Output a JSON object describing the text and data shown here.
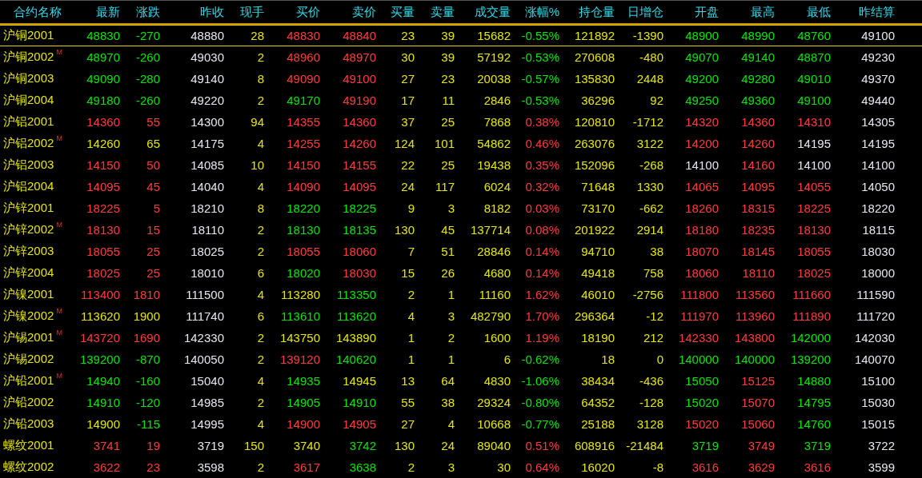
{
  "table": {
    "columns": [
      "合约名称",
      "最新",
      "涨跌",
      "昨收",
      "现手",
      "买价",
      "卖价",
      "买量",
      "卖量",
      "成交量",
      "涨幅%",
      "持仓量",
      "日增仓",
      "开盘",
      "最高",
      "最低",
      "昨结算"
    ],
    "rows": [
      {
        "selected": true,
        "cells": [
          {
            "text": "沪铜2001"
          },
          {
            "text": "48830",
            "color": "#00e600"
          },
          {
            "text": "-270",
            "color": "#00e600"
          },
          {
            "text": "48880",
            "color": "#e6e6f0"
          },
          {
            "text": "28",
            "color": "#e6e600"
          },
          {
            "text": "48830",
            "color": "#ff3c3c"
          },
          {
            "text": "48840",
            "color": "#ff3c3c"
          },
          {
            "text": "23",
            "color": "#e6e600"
          },
          {
            "text": "39",
            "color": "#e6e600"
          },
          {
            "text": "15682",
            "color": "#e6e600"
          },
          {
            "text": "-0.55%",
            "color": "#00e600"
          },
          {
            "text": "121892",
            "color": "#e6e600"
          },
          {
            "text": "-1390",
            "color": "#e6e600"
          },
          {
            "text": "48900",
            "color": "#00e600"
          },
          {
            "text": "48990",
            "color": "#00e600"
          },
          {
            "text": "48760",
            "color": "#00e600"
          },
          {
            "text": "49100",
            "color": "#e6e6f0"
          }
        ]
      },
      {
        "selected": false,
        "cells": [
          {
            "text": "沪铜2002",
            "marker": "M"
          },
          {
            "text": "48970",
            "color": "#00e600"
          },
          {
            "text": "-260",
            "color": "#00e600"
          },
          {
            "text": "49030",
            "color": "#e6e6f0"
          },
          {
            "text": "2",
            "color": "#e6e600"
          },
          {
            "text": "48960",
            "color": "#ff3c3c"
          },
          {
            "text": "48970",
            "color": "#ff3c3c"
          },
          {
            "text": "30",
            "color": "#e6e600"
          },
          {
            "text": "39",
            "color": "#e6e600"
          },
          {
            "text": "57192",
            "color": "#e6e600"
          },
          {
            "text": "-0.53%",
            "color": "#00e600"
          },
          {
            "text": "270608",
            "color": "#e6e600"
          },
          {
            "text": "-480",
            "color": "#e6e600"
          },
          {
            "text": "49070",
            "color": "#00e600"
          },
          {
            "text": "49140",
            "color": "#00e600"
          },
          {
            "text": "48870",
            "color": "#00e600"
          },
          {
            "text": "49230",
            "color": "#e6e6f0"
          }
        ]
      },
      {
        "selected": false,
        "cells": [
          {
            "text": "沪铜2003"
          },
          {
            "text": "49090",
            "color": "#00e600"
          },
          {
            "text": "-280",
            "color": "#00e600"
          },
          {
            "text": "49140",
            "color": "#e6e6f0"
          },
          {
            "text": "8",
            "color": "#e6e600"
          },
          {
            "text": "49090",
            "color": "#ff3c3c"
          },
          {
            "text": "49100",
            "color": "#ff3c3c"
          },
          {
            "text": "27",
            "color": "#e6e600"
          },
          {
            "text": "23",
            "color": "#e6e600"
          },
          {
            "text": "20038",
            "color": "#e6e600"
          },
          {
            "text": "-0.57%",
            "color": "#00e600"
          },
          {
            "text": "135830",
            "color": "#e6e600"
          },
          {
            "text": "2448",
            "color": "#e6e600"
          },
          {
            "text": "49200",
            "color": "#00e600"
          },
          {
            "text": "49280",
            "color": "#00e600"
          },
          {
            "text": "49010",
            "color": "#00e600"
          },
          {
            "text": "49370",
            "color": "#e6e6f0"
          }
        ]
      },
      {
        "selected": false,
        "cells": [
          {
            "text": "沪铜2004"
          },
          {
            "text": "49180",
            "color": "#00e600"
          },
          {
            "text": "-260",
            "color": "#00e600"
          },
          {
            "text": "49220",
            "color": "#e6e6f0"
          },
          {
            "text": "2",
            "color": "#e6e600"
          },
          {
            "text": "49170",
            "color": "#00e600"
          },
          {
            "text": "49190",
            "color": "#ff3c3c"
          },
          {
            "text": "17",
            "color": "#e6e600"
          },
          {
            "text": "11",
            "color": "#e6e600"
          },
          {
            "text": "2846",
            "color": "#e6e600"
          },
          {
            "text": "-0.53%",
            "color": "#00e600"
          },
          {
            "text": "36296",
            "color": "#e6e600"
          },
          {
            "text": "92",
            "color": "#e6e600"
          },
          {
            "text": "49250",
            "color": "#00e600"
          },
          {
            "text": "49360",
            "color": "#00e600"
          },
          {
            "text": "49100",
            "color": "#00e600"
          },
          {
            "text": "49440",
            "color": "#e6e6f0"
          }
        ]
      },
      {
        "selected": false,
        "cells": [
          {
            "text": "沪铝2001"
          },
          {
            "text": "14360",
            "color": "#ff3c3c"
          },
          {
            "text": "55",
            "color": "#ff3c3c"
          },
          {
            "text": "14300",
            "color": "#e6e6f0"
          },
          {
            "text": "94",
            "color": "#e6e600"
          },
          {
            "text": "14355",
            "color": "#ff3c3c"
          },
          {
            "text": "14360",
            "color": "#ff3c3c"
          },
          {
            "text": "37",
            "color": "#e6e600"
          },
          {
            "text": "25",
            "color": "#e6e600"
          },
          {
            "text": "7868",
            "color": "#e6e600"
          },
          {
            "text": "0.38%",
            "color": "#ff3c3c"
          },
          {
            "text": "120810",
            "color": "#e6e600"
          },
          {
            "text": "-1712",
            "color": "#e6e600"
          },
          {
            "text": "14320",
            "color": "#ff3c3c"
          },
          {
            "text": "14360",
            "color": "#ff3c3c"
          },
          {
            "text": "14310",
            "color": "#ff3c3c"
          },
          {
            "text": "14305",
            "color": "#e6e6f0"
          }
        ]
      },
      {
        "selected": false,
        "cells": [
          {
            "text": "沪铝2002",
            "marker": "M"
          },
          {
            "text": "14260",
            "color": "#e6e600"
          },
          {
            "text": "65",
            "color": "#e6e600"
          },
          {
            "text": "14175",
            "color": "#e6e6f0"
          },
          {
            "text": "4",
            "color": "#e6e600"
          },
          {
            "text": "14255",
            "color": "#ff3c3c"
          },
          {
            "text": "14260",
            "color": "#ff3c3c"
          },
          {
            "text": "124",
            "color": "#e6e600"
          },
          {
            "text": "101",
            "color": "#e6e600"
          },
          {
            "text": "54862",
            "color": "#e6e600"
          },
          {
            "text": "0.46%",
            "color": "#ff3c3c"
          },
          {
            "text": "263076",
            "color": "#e6e600"
          },
          {
            "text": "3122",
            "color": "#e6e600"
          },
          {
            "text": "14200",
            "color": "#ff3c3c"
          },
          {
            "text": "14260",
            "color": "#ff3c3c"
          },
          {
            "text": "14195",
            "color": "#e6e6f0"
          },
          {
            "text": "14195",
            "color": "#e6e6f0"
          }
        ]
      },
      {
        "selected": false,
        "cells": [
          {
            "text": "沪铝2003"
          },
          {
            "text": "14150",
            "color": "#ff3c3c"
          },
          {
            "text": "50",
            "color": "#ff3c3c"
          },
          {
            "text": "14085",
            "color": "#e6e6f0"
          },
          {
            "text": "10",
            "color": "#e6e600"
          },
          {
            "text": "14150",
            "color": "#ff3c3c"
          },
          {
            "text": "14155",
            "color": "#ff3c3c"
          },
          {
            "text": "22",
            "color": "#e6e600"
          },
          {
            "text": "25",
            "color": "#e6e600"
          },
          {
            "text": "19438",
            "color": "#e6e600"
          },
          {
            "text": "0.35%",
            "color": "#ff3c3c"
          },
          {
            "text": "152096",
            "color": "#e6e600"
          },
          {
            "text": "-268",
            "color": "#e6e600"
          },
          {
            "text": "14100",
            "color": "#e6e6f0"
          },
          {
            "text": "14160",
            "color": "#ff3c3c"
          },
          {
            "text": "14100",
            "color": "#e6e6f0"
          },
          {
            "text": "14100",
            "color": "#e6e6f0"
          }
        ]
      },
      {
        "selected": false,
        "cells": [
          {
            "text": "沪铝2004"
          },
          {
            "text": "14095",
            "color": "#ff3c3c"
          },
          {
            "text": "45",
            "color": "#ff3c3c"
          },
          {
            "text": "14040",
            "color": "#e6e6f0"
          },
          {
            "text": "4",
            "color": "#e6e600"
          },
          {
            "text": "14090",
            "color": "#ff3c3c"
          },
          {
            "text": "14095",
            "color": "#ff3c3c"
          },
          {
            "text": "24",
            "color": "#e6e600"
          },
          {
            "text": "117",
            "color": "#e6e600"
          },
          {
            "text": "6024",
            "color": "#e6e600"
          },
          {
            "text": "0.32%",
            "color": "#ff3c3c"
          },
          {
            "text": "71648",
            "color": "#e6e600"
          },
          {
            "text": "1330",
            "color": "#e6e600"
          },
          {
            "text": "14065",
            "color": "#ff3c3c"
          },
          {
            "text": "14095",
            "color": "#ff3c3c"
          },
          {
            "text": "14055",
            "color": "#ff3c3c"
          },
          {
            "text": "14050",
            "color": "#e6e6f0"
          }
        ]
      },
      {
        "selected": false,
        "cells": [
          {
            "text": "沪锌2001"
          },
          {
            "text": "18225",
            "color": "#ff3c3c"
          },
          {
            "text": "5",
            "color": "#ff3c3c"
          },
          {
            "text": "18210",
            "color": "#e6e6f0"
          },
          {
            "text": "8",
            "color": "#e6e600"
          },
          {
            "text": "18220",
            "color": "#00e600"
          },
          {
            "text": "18225",
            "color": "#00e600"
          },
          {
            "text": "9",
            "color": "#e6e600"
          },
          {
            "text": "3",
            "color": "#e6e600"
          },
          {
            "text": "8182",
            "color": "#e6e600"
          },
          {
            "text": "0.03%",
            "color": "#ff3c3c"
          },
          {
            "text": "73170",
            "color": "#e6e600"
          },
          {
            "text": "-662",
            "color": "#e6e600"
          },
          {
            "text": "18260",
            "color": "#ff3c3c"
          },
          {
            "text": "18315",
            "color": "#ff3c3c"
          },
          {
            "text": "18225",
            "color": "#ff3c3c"
          },
          {
            "text": "18220",
            "color": "#e6e6f0"
          }
        ]
      },
      {
        "selected": false,
        "cells": [
          {
            "text": "沪锌2002",
            "marker": "M"
          },
          {
            "text": "18130",
            "color": "#ff3c3c"
          },
          {
            "text": "15",
            "color": "#ff3c3c"
          },
          {
            "text": "18110",
            "color": "#e6e6f0"
          },
          {
            "text": "2",
            "color": "#e6e600"
          },
          {
            "text": "18130",
            "color": "#00e600"
          },
          {
            "text": "18135",
            "color": "#00e600"
          },
          {
            "text": "130",
            "color": "#e6e600"
          },
          {
            "text": "45",
            "color": "#e6e600"
          },
          {
            "text": "137714",
            "color": "#e6e600"
          },
          {
            "text": "0.08%",
            "color": "#ff3c3c"
          },
          {
            "text": "201922",
            "color": "#e6e600"
          },
          {
            "text": "2914",
            "color": "#e6e600"
          },
          {
            "text": "18180",
            "color": "#ff3c3c"
          },
          {
            "text": "18235",
            "color": "#ff3c3c"
          },
          {
            "text": "18130",
            "color": "#ff3c3c"
          },
          {
            "text": "18115",
            "color": "#e6e6f0"
          }
        ]
      },
      {
        "selected": false,
        "cells": [
          {
            "text": "沪锌2003"
          },
          {
            "text": "18055",
            "color": "#ff3c3c"
          },
          {
            "text": "25",
            "color": "#ff3c3c"
          },
          {
            "text": "18025",
            "color": "#e6e6f0"
          },
          {
            "text": "2",
            "color": "#e6e600"
          },
          {
            "text": "18055",
            "color": "#ff3c3c"
          },
          {
            "text": "18060",
            "color": "#ff3c3c"
          },
          {
            "text": "7",
            "color": "#e6e600"
          },
          {
            "text": "51",
            "color": "#e6e600"
          },
          {
            "text": "28846",
            "color": "#e6e600"
          },
          {
            "text": "0.14%",
            "color": "#ff3c3c"
          },
          {
            "text": "94710",
            "color": "#e6e600"
          },
          {
            "text": "38",
            "color": "#e6e600"
          },
          {
            "text": "18070",
            "color": "#ff3c3c"
          },
          {
            "text": "18145",
            "color": "#ff3c3c"
          },
          {
            "text": "18055",
            "color": "#ff3c3c"
          },
          {
            "text": "18030",
            "color": "#e6e6f0"
          }
        ]
      },
      {
        "selected": false,
        "cells": [
          {
            "text": "沪锌2004"
          },
          {
            "text": "18025",
            "color": "#ff3c3c"
          },
          {
            "text": "25",
            "color": "#ff3c3c"
          },
          {
            "text": "18010",
            "color": "#e6e6f0"
          },
          {
            "text": "6",
            "color": "#e6e600"
          },
          {
            "text": "18020",
            "color": "#00e600"
          },
          {
            "text": "18030",
            "color": "#ff3c3c"
          },
          {
            "text": "15",
            "color": "#e6e600"
          },
          {
            "text": "26",
            "color": "#e6e600"
          },
          {
            "text": "4680",
            "color": "#e6e600"
          },
          {
            "text": "0.14%",
            "color": "#ff3c3c"
          },
          {
            "text": "49418",
            "color": "#e6e600"
          },
          {
            "text": "758",
            "color": "#e6e600"
          },
          {
            "text": "18060",
            "color": "#ff3c3c"
          },
          {
            "text": "18110",
            "color": "#ff3c3c"
          },
          {
            "text": "18025",
            "color": "#ff3c3c"
          },
          {
            "text": "18000",
            "color": "#e6e6f0"
          }
        ]
      },
      {
        "selected": false,
        "cells": [
          {
            "text": "沪镍2001"
          },
          {
            "text": "113400",
            "color": "#ff3c3c"
          },
          {
            "text": "1810",
            "color": "#ff3c3c"
          },
          {
            "text": "111500",
            "color": "#e6e6f0"
          },
          {
            "text": "4",
            "color": "#e6e600"
          },
          {
            "text": "113280",
            "color": "#e6e600"
          },
          {
            "text": "113350",
            "color": "#00e600"
          },
          {
            "text": "2",
            "color": "#e6e600"
          },
          {
            "text": "1",
            "color": "#e6e600"
          },
          {
            "text": "11160",
            "color": "#e6e600"
          },
          {
            "text": "1.62%",
            "color": "#ff3c3c"
          },
          {
            "text": "46010",
            "color": "#e6e600"
          },
          {
            "text": "-2756",
            "color": "#e6e600"
          },
          {
            "text": "111800",
            "color": "#ff3c3c"
          },
          {
            "text": "113560",
            "color": "#ff3c3c"
          },
          {
            "text": "111660",
            "color": "#ff3c3c"
          },
          {
            "text": "111590",
            "color": "#e6e6f0"
          }
        ]
      },
      {
        "selected": false,
        "cells": [
          {
            "text": "沪镍2002",
            "marker": "M"
          },
          {
            "text": "113620",
            "color": "#e6e600"
          },
          {
            "text": "1900",
            "color": "#e6e600"
          },
          {
            "text": "111740",
            "color": "#e6e6f0"
          },
          {
            "text": "6",
            "color": "#e6e600"
          },
          {
            "text": "113610",
            "color": "#00e600"
          },
          {
            "text": "113620",
            "color": "#00e600"
          },
          {
            "text": "4",
            "color": "#e6e600"
          },
          {
            "text": "3",
            "color": "#e6e600"
          },
          {
            "text": "482790",
            "color": "#e6e600"
          },
          {
            "text": "1.70%",
            "color": "#ff3c3c"
          },
          {
            "text": "296364",
            "color": "#e6e600"
          },
          {
            "text": "-12",
            "color": "#e6e600"
          },
          {
            "text": "111970",
            "color": "#ff3c3c"
          },
          {
            "text": "113960",
            "color": "#ff3c3c"
          },
          {
            "text": "111890",
            "color": "#ff3c3c"
          },
          {
            "text": "111720",
            "color": "#e6e6f0"
          }
        ]
      },
      {
        "selected": false,
        "cells": [
          {
            "text": "沪锡2001",
            "marker": "M"
          },
          {
            "text": "143720",
            "color": "#ff3c3c"
          },
          {
            "text": "1690",
            "color": "#ff3c3c"
          },
          {
            "text": "142330",
            "color": "#e6e6f0"
          },
          {
            "text": "2",
            "color": "#e6e600"
          },
          {
            "text": "143750",
            "color": "#e6e600"
          },
          {
            "text": "143890",
            "color": "#e6e600"
          },
          {
            "text": "1",
            "color": "#e6e600"
          },
          {
            "text": "2",
            "color": "#e6e600"
          },
          {
            "text": "1600",
            "color": "#e6e600"
          },
          {
            "text": "1.19%",
            "color": "#ff3c3c"
          },
          {
            "text": "18190",
            "color": "#e6e600"
          },
          {
            "text": "212",
            "color": "#e6e600"
          },
          {
            "text": "142330",
            "color": "#ff3c3c"
          },
          {
            "text": "143800",
            "color": "#ff3c3c"
          },
          {
            "text": "142000",
            "color": "#00e600"
          },
          {
            "text": "142030",
            "color": "#e6e6f0"
          }
        ]
      },
      {
        "selected": false,
        "cells": [
          {
            "text": "沪锡2002"
          },
          {
            "text": "139200",
            "color": "#00e600"
          },
          {
            "text": "-870",
            "color": "#00e600"
          },
          {
            "text": "140050",
            "color": "#e6e6f0"
          },
          {
            "text": "2",
            "color": "#e6e600"
          },
          {
            "text": "139120",
            "color": "#ff3c3c"
          },
          {
            "text": "140620",
            "color": "#00e600"
          },
          {
            "text": "1",
            "color": "#e6e600"
          },
          {
            "text": "1",
            "color": "#e6e600"
          },
          {
            "text": "6",
            "color": "#e6e600"
          },
          {
            "text": "-0.62%",
            "color": "#00e600"
          },
          {
            "text": "18",
            "color": "#e6e600"
          },
          {
            "text": "0",
            "color": "#e6e600"
          },
          {
            "text": "140000",
            "color": "#00e600"
          },
          {
            "text": "140000",
            "color": "#00e600"
          },
          {
            "text": "139200",
            "color": "#00e600"
          },
          {
            "text": "140070",
            "color": "#e6e6f0"
          }
        ]
      },
      {
        "selected": false,
        "cells": [
          {
            "text": "沪铅2001",
            "marker": "M"
          },
          {
            "text": "14940",
            "color": "#00e600"
          },
          {
            "text": "-160",
            "color": "#00e600"
          },
          {
            "text": "15040",
            "color": "#e6e6f0"
          },
          {
            "text": "4",
            "color": "#e6e600"
          },
          {
            "text": "14935",
            "color": "#00e600"
          },
          {
            "text": "14945",
            "color": "#e6e600"
          },
          {
            "text": "13",
            "color": "#e6e600"
          },
          {
            "text": "64",
            "color": "#e6e600"
          },
          {
            "text": "4830",
            "color": "#e6e600"
          },
          {
            "text": "-1.06%",
            "color": "#00e600"
          },
          {
            "text": "38434",
            "color": "#e6e600"
          },
          {
            "text": "-436",
            "color": "#e6e600"
          },
          {
            "text": "15050",
            "color": "#00e600"
          },
          {
            "text": "15125",
            "color": "#ff3c3c"
          },
          {
            "text": "14880",
            "color": "#00e600"
          },
          {
            "text": "15100",
            "color": "#e6e6f0"
          }
        ]
      },
      {
        "selected": false,
        "cells": [
          {
            "text": "沪铅2002"
          },
          {
            "text": "14910",
            "color": "#00e600"
          },
          {
            "text": "-120",
            "color": "#00e600"
          },
          {
            "text": "14985",
            "color": "#e6e6f0"
          },
          {
            "text": "2",
            "color": "#e6e600"
          },
          {
            "text": "14905",
            "color": "#00e600"
          },
          {
            "text": "14910",
            "color": "#00e600"
          },
          {
            "text": "55",
            "color": "#e6e600"
          },
          {
            "text": "38",
            "color": "#e6e600"
          },
          {
            "text": "29324",
            "color": "#e6e600"
          },
          {
            "text": "-0.80%",
            "color": "#00e600"
          },
          {
            "text": "64352",
            "color": "#e6e600"
          },
          {
            "text": "-128",
            "color": "#e6e600"
          },
          {
            "text": "15020",
            "color": "#00e600"
          },
          {
            "text": "15070",
            "color": "#ff3c3c"
          },
          {
            "text": "14795",
            "color": "#00e600"
          },
          {
            "text": "15030",
            "color": "#e6e6f0"
          }
        ]
      },
      {
        "selected": false,
        "cells": [
          {
            "text": "沪铅2003"
          },
          {
            "text": "14900",
            "color": "#e6e600"
          },
          {
            "text": "-115",
            "color": "#00e600"
          },
          {
            "text": "14995",
            "color": "#e6e6f0"
          },
          {
            "text": "4",
            "color": "#e6e600"
          },
          {
            "text": "14900",
            "color": "#ff3c3c"
          },
          {
            "text": "14905",
            "color": "#ff3c3c"
          },
          {
            "text": "27",
            "color": "#e6e600"
          },
          {
            "text": "4",
            "color": "#e6e600"
          },
          {
            "text": "10668",
            "color": "#e6e600"
          },
          {
            "text": "-0.77%",
            "color": "#00e600"
          },
          {
            "text": "25188",
            "color": "#e6e600"
          },
          {
            "text": "3128",
            "color": "#e6e600"
          },
          {
            "text": "15020",
            "color": "#ff3c3c"
          },
          {
            "text": "15060",
            "color": "#ff3c3c"
          },
          {
            "text": "14760",
            "color": "#00e600"
          },
          {
            "text": "15015",
            "color": "#e6e6f0"
          }
        ]
      },
      {
        "selected": false,
        "cells": [
          {
            "text": "螺纹2001"
          },
          {
            "text": "3741",
            "color": "#ff3c3c"
          },
          {
            "text": "19",
            "color": "#ff3c3c"
          },
          {
            "text": "3719",
            "color": "#e6e6f0"
          },
          {
            "text": "150",
            "color": "#e6e600"
          },
          {
            "text": "3740",
            "color": "#e6e600"
          },
          {
            "text": "3742",
            "color": "#00e600"
          },
          {
            "text": "130",
            "color": "#e6e600"
          },
          {
            "text": "24",
            "color": "#e6e600"
          },
          {
            "text": "89040",
            "color": "#e6e600"
          },
          {
            "text": "0.51%",
            "color": "#ff3c3c"
          },
          {
            "text": "608916",
            "color": "#e6e600"
          },
          {
            "text": "-21484",
            "color": "#e6e600"
          },
          {
            "text": "3719",
            "color": "#00e600"
          },
          {
            "text": "3749",
            "color": "#ff3c3c"
          },
          {
            "text": "3719",
            "color": "#00e600"
          },
          {
            "text": "3722",
            "color": "#e6e6f0"
          }
        ]
      },
      {
        "selected": false,
        "cells": [
          {
            "text": "螺纹2002"
          },
          {
            "text": "3622",
            "color": "#ff3c3c"
          },
          {
            "text": "23",
            "color": "#ff3c3c"
          },
          {
            "text": "3598",
            "color": "#e6e6f0"
          },
          {
            "text": "2",
            "color": "#e6e600"
          },
          {
            "text": "3617",
            "color": "#ff3c3c"
          },
          {
            "text": "3638",
            "color": "#00e600"
          },
          {
            "text": "2",
            "color": "#e6e600"
          },
          {
            "text": "3",
            "color": "#e6e600"
          },
          {
            "text": "30",
            "color": "#e6e600"
          },
          {
            "text": "0.64%",
            "color": "#ff3c3c"
          },
          {
            "text": "16020",
            "color": "#e6e600"
          },
          {
            "text": "-8",
            "color": "#e6e600"
          },
          {
            "text": "3616",
            "color": "#ff3c3c"
          },
          {
            "text": "3629",
            "color": "#ff3c3c"
          },
          {
            "text": "3616",
            "color": "#ff3c3c"
          },
          {
            "text": "3599",
            "color": "#e6e6f0"
          }
        ]
      }
    ]
  }
}
